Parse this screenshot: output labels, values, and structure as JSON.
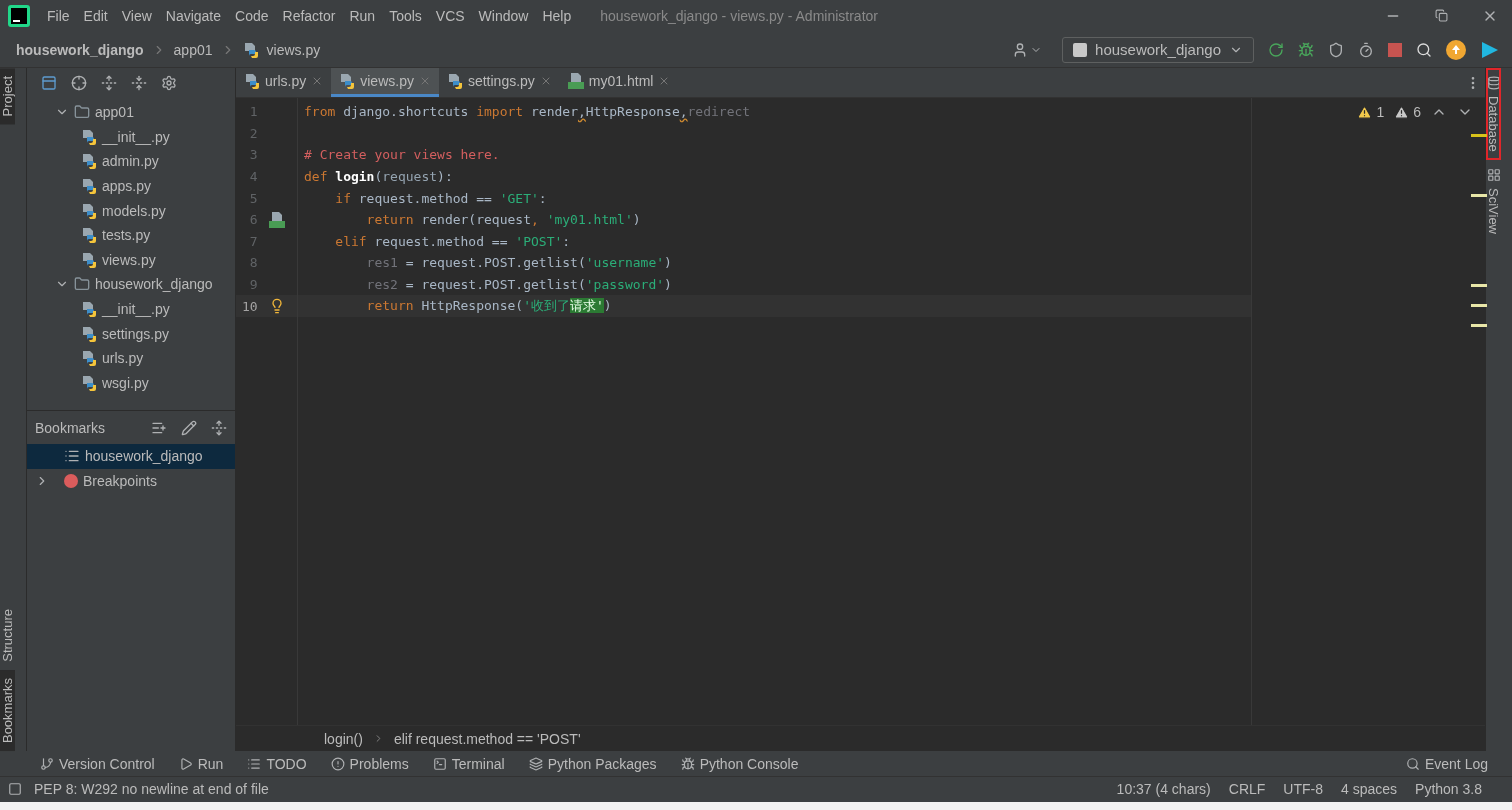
{
  "menu_bar": {
    "items": [
      "File",
      "Edit",
      "View",
      "Navigate",
      "Code",
      "Refactor",
      "Run",
      "Tools",
      "VCS",
      "Window",
      "Help"
    ],
    "title": "housework_django - views.py - Administrator"
  },
  "nav_bar": {
    "breadcrumbs": [
      "housework_django",
      "app01",
      "views.py"
    ],
    "run_config": "housework_django"
  },
  "left_stripe": [
    {
      "label": "Project",
      "selected": true,
      "kind": "top"
    },
    {
      "label": "Structure",
      "selected": false,
      "kind": "bottom"
    },
    {
      "label": "Bookmarks",
      "selected": true,
      "kind": "bottom"
    }
  ],
  "project_tree": [
    {
      "label": "app01",
      "kind": "folder",
      "expanded": true,
      "children": [
        {
          "label": "__init__.py",
          "kind": "python"
        },
        {
          "label": "admin.py",
          "kind": "python"
        },
        {
          "label": "apps.py",
          "kind": "python"
        },
        {
          "label": "models.py",
          "kind": "python"
        },
        {
          "label": "tests.py",
          "kind": "python"
        },
        {
          "label": "views.py",
          "kind": "python"
        }
      ]
    },
    {
      "label": "housework_django",
      "kind": "folder",
      "expanded": true,
      "children": [
        {
          "label": "__init__.py",
          "kind": "python"
        },
        {
          "label": "settings.py",
          "kind": "python"
        },
        {
          "label": "urls.py",
          "kind": "python"
        },
        {
          "label": "wsgi.py",
          "kind": "python"
        }
      ]
    }
  ],
  "bookmarks": {
    "title": "Bookmarks",
    "items": [
      {
        "label": "housework_django",
        "kind": "list",
        "selected": true
      },
      {
        "label": "Breakpoints",
        "kind": "breakpoint",
        "selected": false,
        "expanded": false
      }
    ]
  },
  "editor_tabs": [
    {
      "label": "urls.py",
      "kind": "python",
      "selected": false
    },
    {
      "label": "views.py",
      "kind": "python",
      "selected": true
    },
    {
      "label": "settings.py",
      "kind": "python",
      "selected": false
    },
    {
      "label": "my01.html",
      "kind": "html",
      "selected": false
    }
  ],
  "inspections": [
    {
      "kind": "warning",
      "count": "1"
    },
    {
      "kind": "weak",
      "count": "6"
    }
  ],
  "code_lines": [
    {
      "number": "1",
      "current": false,
      "kind": "plain",
      "tokens": [
        {
          "kind": "keyword",
          "text": "from"
        },
        {
          "kind": "plain",
          "text": " django.shortcuts "
        },
        {
          "kind": "keyword",
          "text": "import"
        },
        {
          "kind": "plain",
          "text": " render"
        },
        {
          "kind": "warn",
          "text": ","
        },
        {
          "kind": "plain",
          "text": "HttpResponse"
        },
        {
          "kind": "warn",
          "text": ","
        },
        {
          "kind": "unused",
          "text": "redirect"
        }
      ]
    },
    {
      "number": "2",
      "current": false,
      "kind": "plain"
    },
    {
      "number": "3",
      "current": false,
      "kind": "plain",
      "tokens": [
        {
          "kind": "comment",
          "text": "# Create your views here."
        }
      ]
    },
    {
      "number": "4",
      "current": false,
      "kind": "plain",
      "tokens": [
        {
          "kind": "keyword",
          "text": "def"
        },
        {
          "kind": "func",
          "text": " login"
        },
        {
          "kind": "plain",
          "text": "("
        },
        {
          "kind": "param",
          "text": "request"
        },
        {
          "kind": "plain",
          "text": "):"
        }
      ]
    },
    {
      "number": "5",
      "current": false,
      "kind": "plain",
      "tokens": [
        {
          "kind": "keyword",
          "text": "    if"
        },
        {
          "kind": "plain",
          "text": " request.method == "
        },
        {
          "kind": "string",
          "text": "'GET'"
        },
        {
          "kind": "plain",
          "text": ":"
        }
      ]
    },
    {
      "number": "6",
      "current": false,
      "kind": "linked",
      "tokens": [
        {
          "kind": "keyword",
          "text": "        return"
        },
        {
          "kind": "plain",
          "text": " render(request"
        },
        {
          "kind": "keyword",
          "text": ", "
        },
        {
          "kind": "string",
          "text": "'my01.html'"
        },
        {
          "kind": "plain",
          "text": ")"
        }
      ]
    },
    {
      "number": "7",
      "current": false,
      "kind": "plain",
      "tokens": [
        {
          "kind": "keyword",
          "text": "    elif"
        },
        {
          "kind": "plain",
          "text": " request.method == "
        },
        {
          "kind": "string",
          "text": "'POST'"
        },
        {
          "kind": "plain",
          "text": ":"
        }
      ]
    },
    {
      "number": "8",
      "current": false,
      "kind": "plain",
      "tokens": [
        {
          "kind": "unused",
          "text": "        res1"
        },
        {
          "kind": "plain",
          "text": " = request.POST.getlist("
        },
        {
          "kind": "string",
          "text": "'username'"
        },
        {
          "kind": "plain",
          "text": ")"
        }
      ]
    },
    {
      "number": "9",
      "current": false,
      "kind": "plain",
      "tokens": [
        {
          "kind": "unused",
          "text": "        res2"
        },
        {
          "kind": "plain",
          "text": " = request.POST.getlist("
        },
        {
          "kind": "string",
          "text": "'password'"
        },
        {
          "kind": "plain",
          "text": ")"
        }
      ]
    },
    {
      "number": "10",
      "current": true,
      "kind": "intention",
      "tokens": [
        {
          "kind": "keyword",
          "text": "        return"
        },
        {
          "kind": "plain",
          "text": " HttpResponse("
        },
        {
          "kind": "string",
          "text": "'收到了"
        },
        {
          "kind": "highlight",
          "text": "请求'"
        },
        {
          "kind": "plain",
          "text": ")"
        }
      ]
    }
  ],
  "editor_breadcrumbs": [
    "login()",
    "elif request.method == 'POST'"
  ],
  "right_stripe": [
    {
      "label": "Database",
      "selected": true
    },
    {
      "label": "SciView",
      "selected": false
    }
  ],
  "tool_windows": [
    {
      "label": "Version Control",
      "kind": "vcs"
    },
    {
      "label": "Run",
      "kind": "run"
    },
    {
      "label": "TODO",
      "kind": "todo"
    },
    {
      "label": "Problems",
      "kind": "problems"
    },
    {
      "label": "Terminal",
      "kind": "terminal"
    },
    {
      "label": "Python Packages",
      "kind": "packages"
    },
    {
      "label": "Python Console",
      "kind": "console"
    }
  ],
  "event_log": "Event Log",
  "status": {
    "message": "PEP 8: W292 no newline at end of file",
    "items": [
      "10:37 (4 chars)",
      "CRLF",
      "UTF-8",
      "4 spaces",
      "Python 3.8"
    ]
  }
}
